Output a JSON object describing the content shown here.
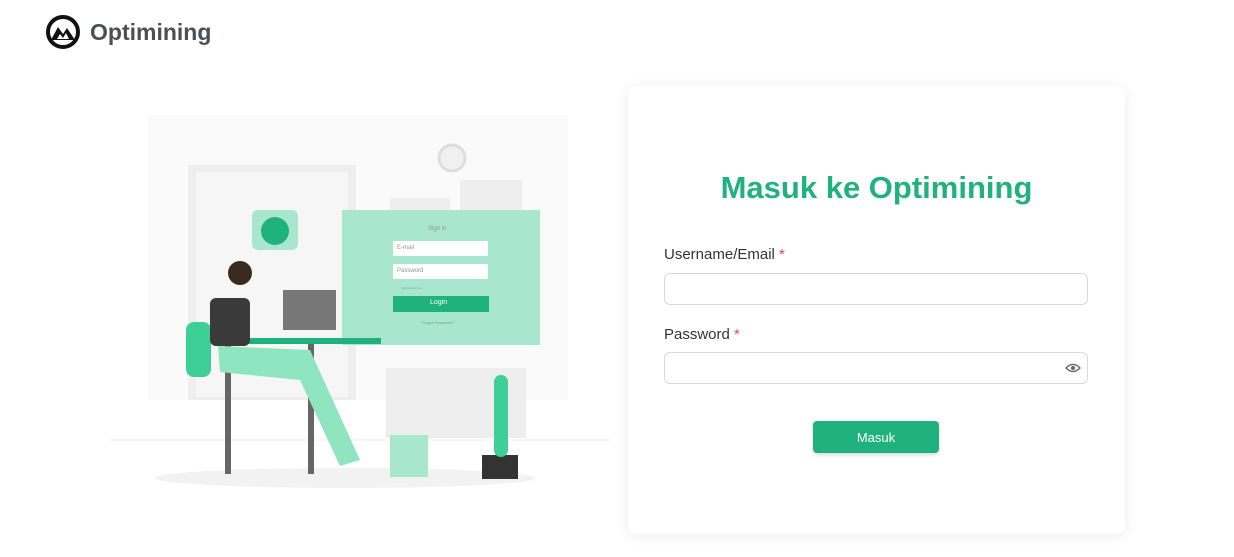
{
  "brand": {
    "name": "Optimining"
  },
  "illustration": {
    "sign_in": "Sign in",
    "email": "E-mail",
    "password": "Password",
    "remember": "Remember me",
    "login": "Login",
    "forgot": "Forgot Password?"
  },
  "form": {
    "title": "Masuk ke Optimining",
    "username_label": "Username/Email",
    "username_value": "",
    "password_label": "Password",
    "password_value": "",
    "required_mark": "*",
    "submit_label": "Masuk"
  },
  "colors": {
    "accent": "#1fb27e",
    "required": "#e5484d"
  }
}
